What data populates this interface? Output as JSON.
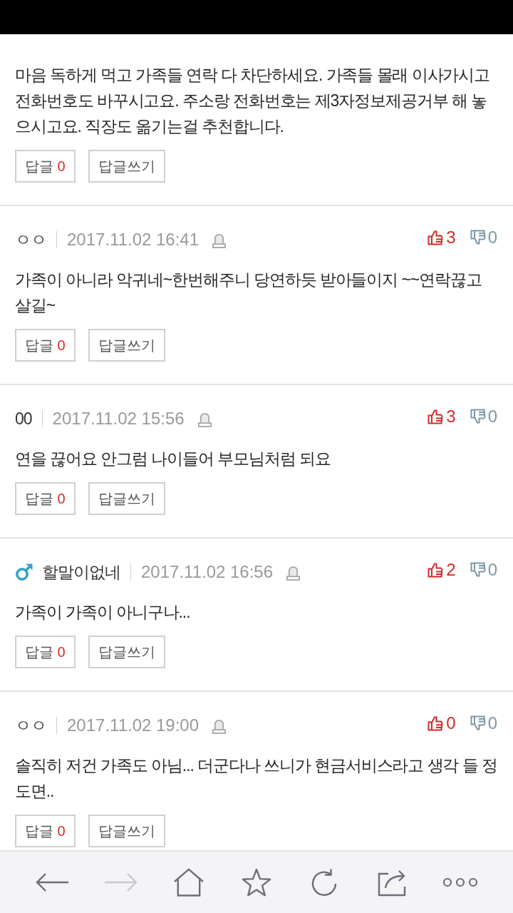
{
  "comments": [
    {
      "body": "마음 독하게 먹고 가족들 연락 다 차단하세요. 가족들 몰래 이사가시고 전화번호도 바꾸시고요. 주소랑 전화번호는 제3자정보제공거부 해 놓으시고요. 직장도 옮기는걸 추천합니다.",
      "reply_button": {
        "label": "답글",
        "count": "0"
      },
      "write_reply_button": "답글쓰기"
    },
    {
      "author": "ㅇㅇ",
      "male": false,
      "date": "2017.11.02 16:41",
      "likes": "3",
      "dislikes": "0",
      "body": "가족이 아니라 악귀네~한번해주니 당연하듯 받아들이지 ~~연락끊고 살길~",
      "reply_button": {
        "label": "답글",
        "count": "0"
      },
      "write_reply_button": "답글쓰기"
    },
    {
      "author": "00",
      "male": false,
      "date": "2017.11.02 15:56",
      "likes": "3",
      "dislikes": "0",
      "body": "연을 끊어요 안그럼 나이들어 부모님처럼 되요",
      "reply_button": {
        "label": "답글",
        "count": "0"
      },
      "write_reply_button": "답글쓰기"
    },
    {
      "author": "할말이없네",
      "male": true,
      "date": "2017.11.02 16:56",
      "likes": "2",
      "dislikes": "0",
      "body": "가족이 가족이 아니구나...",
      "reply_button": {
        "label": "답글",
        "count": "0"
      },
      "write_reply_button": "답글쓰기"
    },
    {
      "author": "ㅇㅇ",
      "male": false,
      "date": "2017.11.02 19:00",
      "likes": "0",
      "dislikes": "0",
      "body": "솔직히 저건 가족도 아님... 더군다나 쓰니가 현금서비스라고 생각 들 정도면..",
      "reply_button": {
        "label": "답글",
        "count": "0"
      },
      "write_reply_button": "답글쓰기"
    }
  ],
  "toolbar": [
    {
      "kind": "back",
      "disabled": false
    },
    {
      "kind": "forward",
      "disabled": true
    },
    {
      "kind": "home",
      "disabled": false
    },
    {
      "kind": "star",
      "disabled": false
    },
    {
      "kind": "refresh",
      "disabled": false
    },
    {
      "kind": "share",
      "disabled": false
    },
    {
      "kind": "more",
      "disabled": false
    }
  ]
}
